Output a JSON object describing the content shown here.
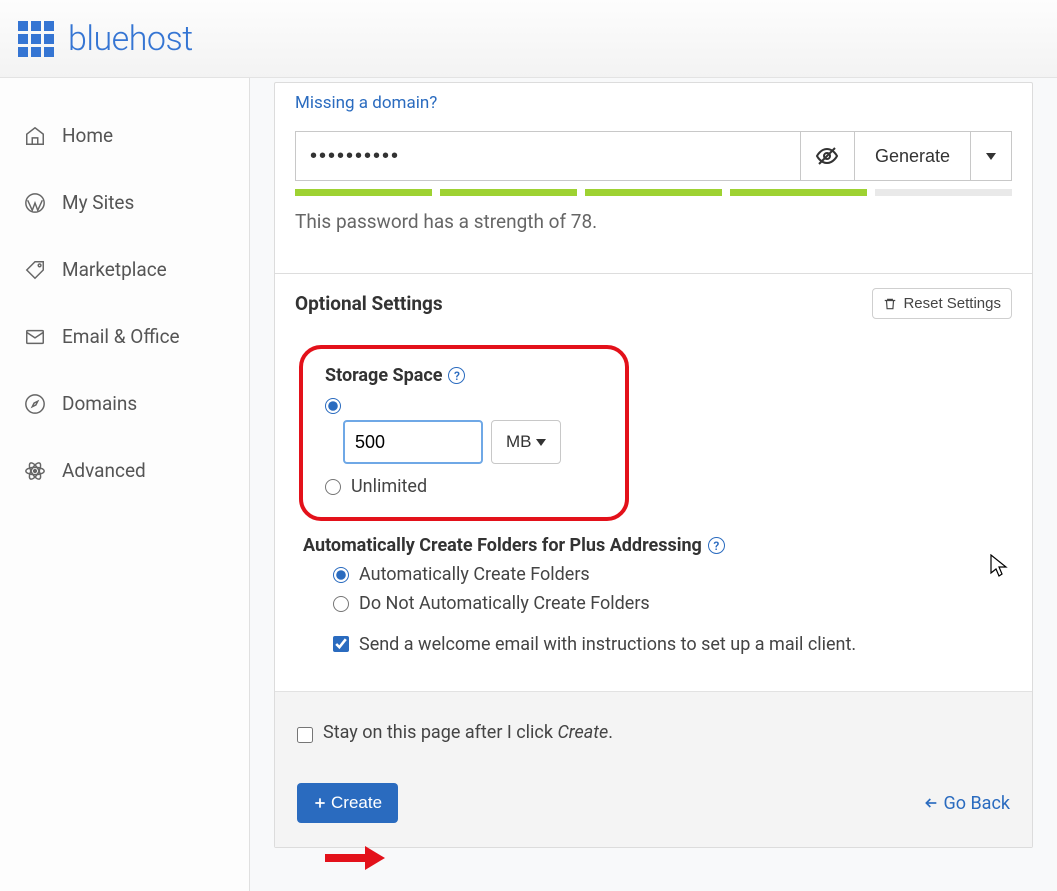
{
  "brand": "bluehost",
  "sidebar": {
    "items": [
      {
        "label": "Home"
      },
      {
        "label": "My Sites"
      },
      {
        "label": "Marketplace"
      },
      {
        "label": "Email & Office"
      },
      {
        "label": "Domains"
      },
      {
        "label": "Advanced"
      }
    ]
  },
  "form": {
    "missing_domain_link": "Missing a domain?",
    "password_value": "••••••••••",
    "generate_label": "Generate",
    "strength_filled_bars": 4,
    "strength_total_bars": 5,
    "strength_text": "This password has a strength of 78.",
    "optional_settings_title": "Optional Settings",
    "reset_settings_label": "Reset Settings",
    "storage": {
      "label": "Storage Space",
      "value": "500",
      "unit": "MB",
      "unlimited_label": "Unlimited",
      "selected": "custom"
    },
    "plus_addressing": {
      "label": "Automatically Create Folders for Plus Addressing",
      "option_auto": "Automatically Create Folders",
      "option_no": "Do Not Automatically Create Folders",
      "selected": "auto"
    },
    "welcome_email": {
      "text": "Send a welcome email with instructions to set up a mail client.",
      "checked": true
    },
    "stay_on_page": {
      "text_prefix": "Stay on this page after I click ",
      "text_emph": "Create",
      "text_suffix": ".",
      "checked": false
    },
    "create_button": "Create",
    "go_back": "Go Back"
  }
}
